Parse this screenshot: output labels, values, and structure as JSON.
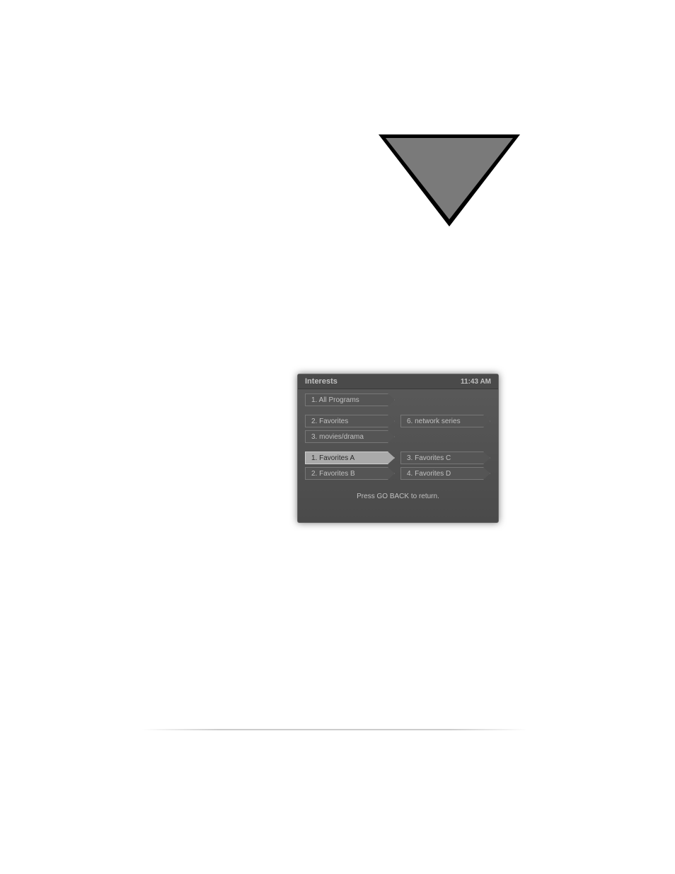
{
  "menu": {
    "title": "Interests",
    "time": "11:43 AM",
    "section1": {
      "item1": "1. All Programs"
    },
    "section2": {
      "item1": "2. Favorites",
      "item2": "3. movies/drama",
      "item3": "6. network series"
    },
    "section3": {
      "item1": "1. Favorites A",
      "item2": "2. Favorites B",
      "item3": "3. Favorites C",
      "item4": "4. Favorites D"
    },
    "footer": "Press GO BACK to return."
  }
}
